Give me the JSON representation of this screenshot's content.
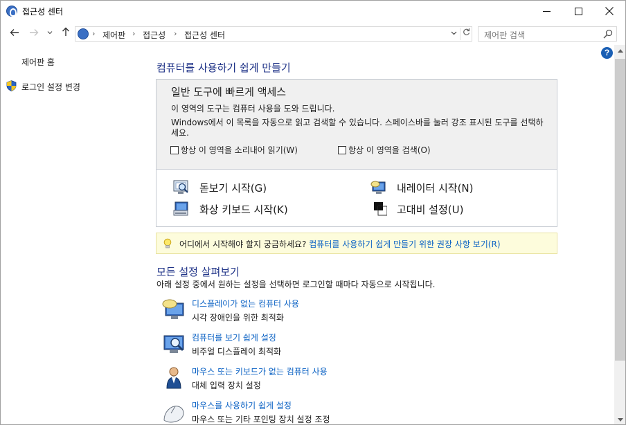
{
  "window": {
    "title": "접근성 센터",
    "icon": "ease-of-access-icon"
  },
  "nav": {
    "breadcrumbs": [
      "제어판",
      "접근성",
      "접근성 센터"
    ],
    "search_placeholder": "제어판 검색"
  },
  "sidebar": {
    "home_label": "제어판 홈",
    "login_label": "로그인 설정 변경"
  },
  "main": {
    "heading": "컴퓨터를 사용하기 쉽게 만들기",
    "quick": {
      "title": "일반 도구에 빠르게 액세스",
      "desc": "이 영역의 도구는 컴퓨터 사용을 도와 드립니다.",
      "desc2": "Windows에서 이 목록을 자동으로 읽고 검색할 수 있습니다. 스페이스바를 눌러 강조 표시된 도구를 선택하세요.",
      "check_read": "항상 이 영역을 소리내어 읽기(W)",
      "check_scan": "항상 이 영역을 검색(O)",
      "tools": {
        "magnifier": "돋보기 시작(G)",
        "narrator": "내레이터 시작(N)",
        "osk": "화상 키보드 시작(K)",
        "contrast": "고대비 설정(U)"
      }
    },
    "tip": {
      "text": "어디에서 시작해야 할지 궁금하세요?",
      "link": "컴퓨터를 사용하기 쉽게 만들기 위한 권장 사항 보기(R)"
    },
    "section": {
      "heading": "모든 설정 살펴보기",
      "desc": "아래 설정 중에서 원하는 설정을 선택하면 로그인할 때마다 자동으로 시작됩니다.",
      "items": [
        {
          "link": "디스플레이가 없는 컴퓨터 사용",
          "sub": "시각 장애인을 위한 최적화",
          "icon": "speech-bubble-monitor-icon"
        },
        {
          "link": "컴퓨터를 보기 쉽게 설정",
          "sub": "비주얼 디스플레이 최적화",
          "icon": "monitor-magnifier-icon"
        },
        {
          "link": "마우스 또는 키보드가 없는 컴퓨터 사용",
          "sub": "대체 입력 장치 설정",
          "icon": "person-icon"
        },
        {
          "link": "마우스를 사용하기 쉽게 설정",
          "sub": "마우스 또는 기타 포인팅 장치 설정 조정",
          "icon": "mouse-icon"
        }
      ]
    }
  }
}
